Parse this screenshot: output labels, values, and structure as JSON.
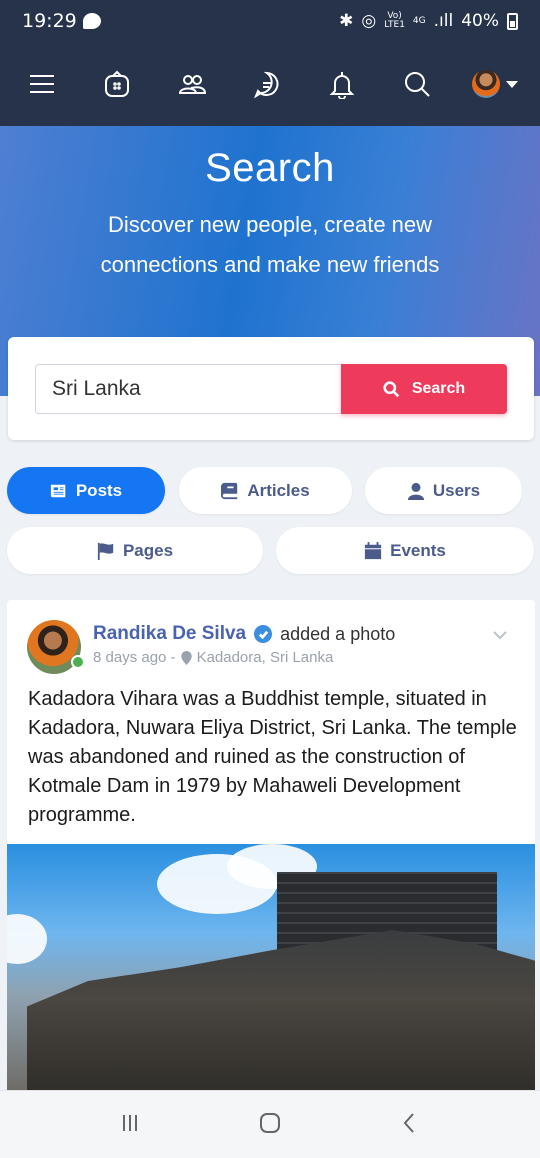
{
  "status_bar": {
    "time": "19:29",
    "network_top": "Vo)",
    "network_bottom": "LTE1",
    "net_gen": "4G",
    "battery": "40%"
  },
  "nav": {
    "icons": [
      "menu-icon",
      "home-icon",
      "friends-icon",
      "messages-icon",
      "notifications-icon",
      "search-icon"
    ]
  },
  "hero": {
    "title": "Search",
    "subtitle": "Discover new people, create new connections and make new friends"
  },
  "search": {
    "value": "Sri Lanka",
    "button_label": "Search"
  },
  "filters": [
    {
      "label": "Posts",
      "icon": "posts-icon",
      "active": true
    },
    {
      "label": "Articles",
      "icon": "articles-icon",
      "active": false
    },
    {
      "label": "Users",
      "icon": "user-icon",
      "active": false
    },
    {
      "label": "Pages",
      "icon": "flag-icon",
      "active": false
    },
    {
      "label": "Events",
      "icon": "calendar-icon",
      "active": false
    }
  ],
  "post": {
    "author": "Randika De Silva",
    "action": "added a photo",
    "time": "8 days ago -",
    "location": "Kadadora, Sri Lanka",
    "text": "Kadadora Vihara was a Buddhist temple, situated in Kadadora, Nuwara Eliya District, Sri Lanka. The temple was abandoned and ruined as the construction of Kotmale Dam in 1979 by Mahaweli Development programme."
  },
  "colors": {
    "nav_bg": "#26334b",
    "accent": "#1476f2",
    "search_btn": "#ee3a5b",
    "author": "#4a63b0"
  }
}
